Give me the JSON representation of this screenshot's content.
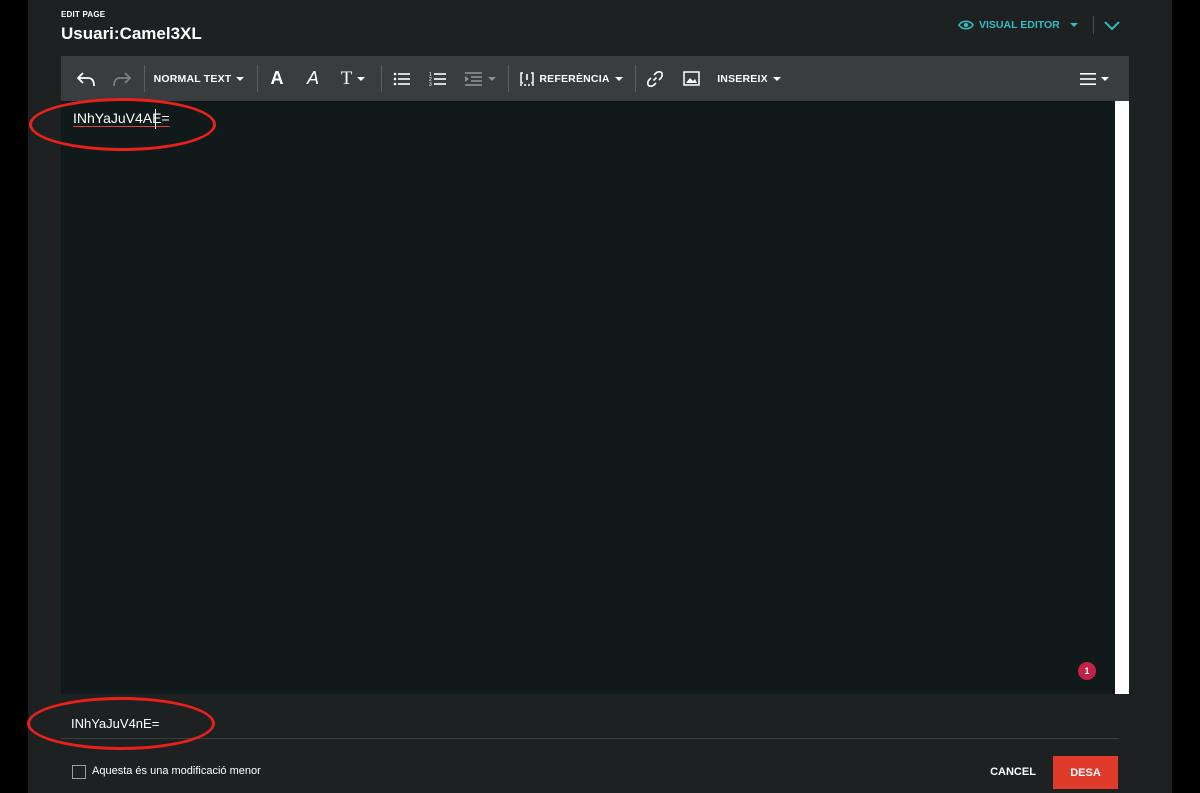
{
  "header": {
    "edit_label": "EDIT PAGE",
    "page_title": "Usuari:Camel3XL",
    "editor_mode": "VISUAL EDITOR"
  },
  "toolbar": {
    "undo_icon": "undo-icon",
    "redo_icon": "redo-icon",
    "format_label": "NORMAL TEXT",
    "bold_glyph": "A",
    "italic_glyph": "A",
    "text_style_glyph": "T",
    "reference_label": "REFERÈNCIA",
    "insert_label": "INSEREIX"
  },
  "editor": {
    "content_text": "INhYaJuV4AE="
  },
  "notification_count": "1",
  "summary": {
    "value": "INhYaJuV4nE="
  },
  "footer": {
    "minor_edit_label": "Aquesta és una modificació menor",
    "cancel_label": "CANCEL",
    "save_label": "DESA"
  },
  "colors": {
    "accent": "#32bdc2",
    "save_button": "#e03a2b",
    "annotation_circle": "#e8221a",
    "notification": "#c32148",
    "spellcheck_underline": "#e0423a"
  }
}
